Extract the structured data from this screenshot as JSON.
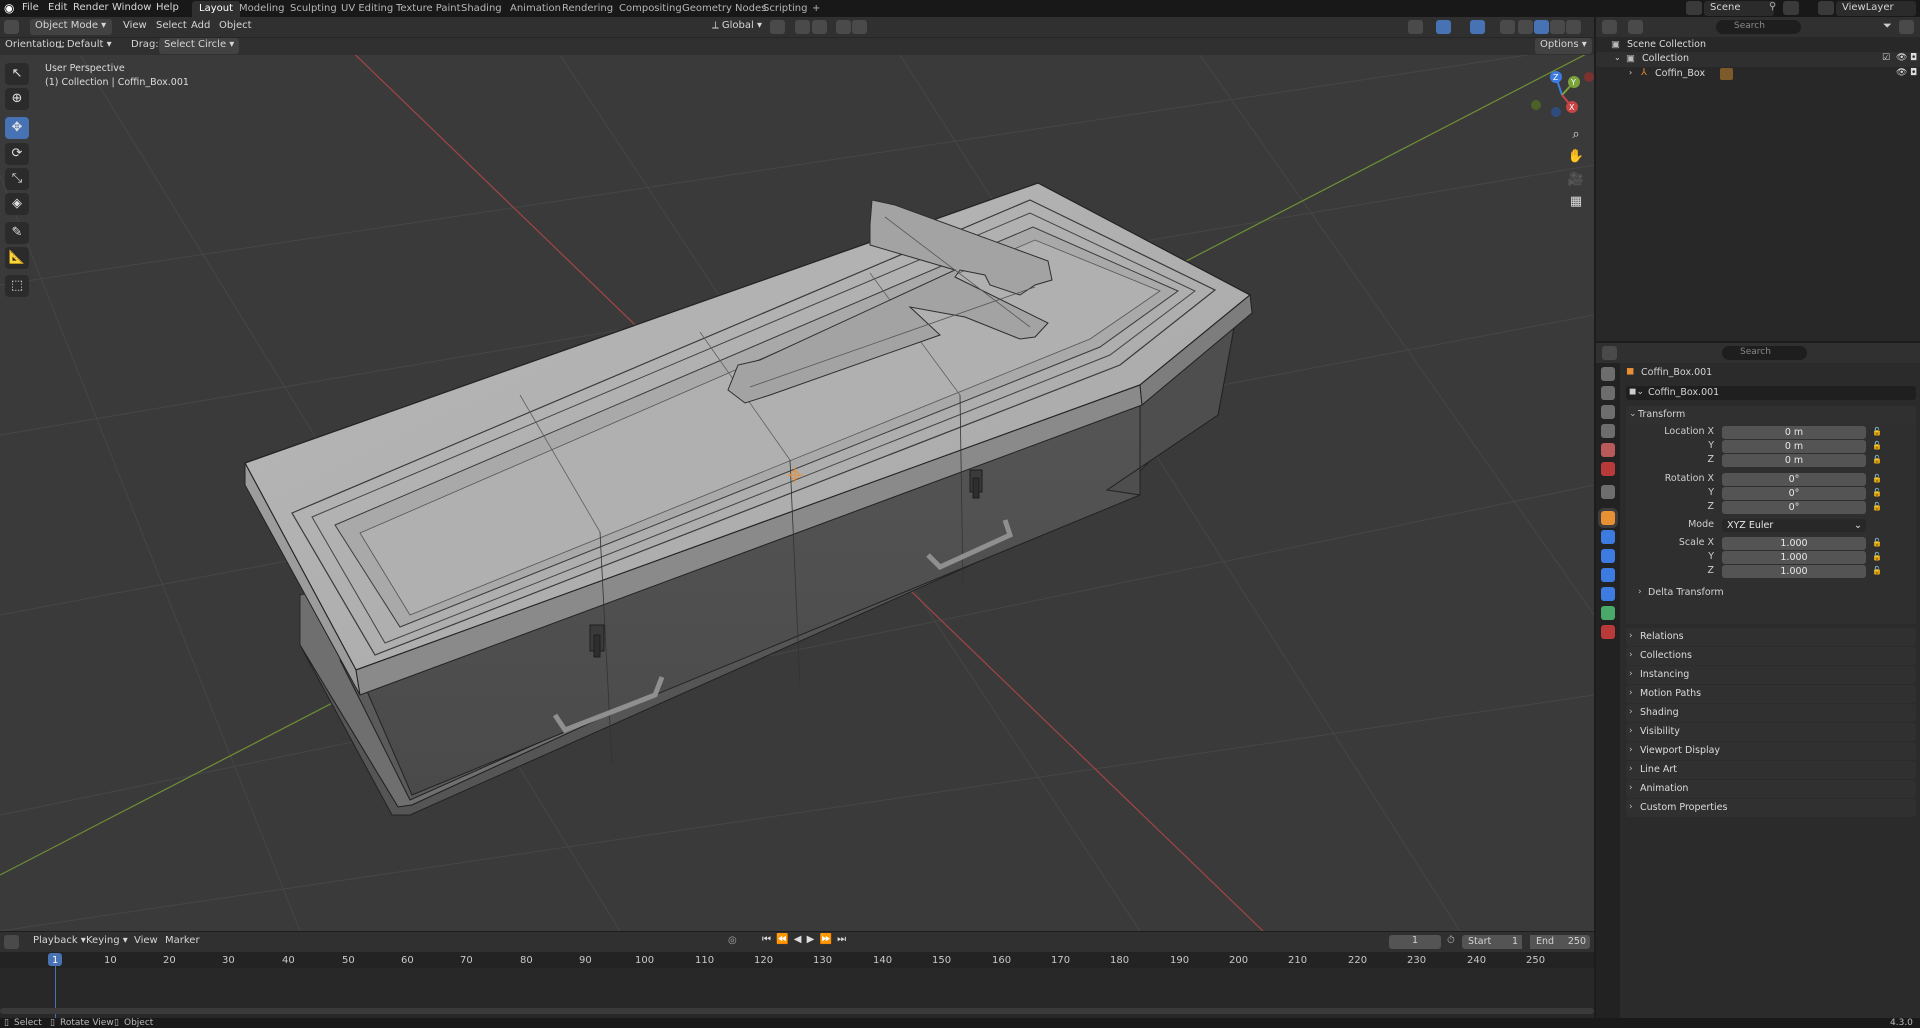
{
  "menu": [
    "File",
    "Edit",
    "Render",
    "Window",
    "Help"
  ],
  "workspaces": [
    "Layout",
    "Modeling",
    "Sculpting",
    "UV Editing",
    "Texture Paint",
    "Shading",
    "Animation",
    "Rendering",
    "Compositing",
    "Geometry Nodes",
    "Scripting"
  ],
  "add_workspace": "+",
  "scene": {
    "name": "Scene",
    "view_layer": "ViewLayer"
  },
  "viewport": {
    "mode": "Object Mode",
    "menus": [
      "View",
      "Select",
      "Add",
      "Object"
    ],
    "transform_orientation": "Global",
    "orientation_label": "Orientation:",
    "orientation_value": "Default",
    "drag_label": "Drag:",
    "drag_value": "Select Circle",
    "options": "Options",
    "overlay_title": "User Perspective",
    "overlay_subtitle": "(1) Collection | Coffin_Box.001",
    "gizmo": {
      "z": "Z",
      "y": "Y",
      "x": "X"
    }
  },
  "outliner": {
    "search_placeholder": "Search",
    "rows": [
      "Scene Collection",
      "Collection",
      "Coffin_Box"
    ]
  },
  "properties": {
    "search_placeholder": "Search",
    "object_name": "Coffin_Box.001",
    "datablock_name": "Coffin_Box.001",
    "transform_title": "Transform",
    "location": {
      "label_x": "Location X",
      "label_y": "Y",
      "label_z": "Z",
      "x": "0 m",
      "y": "0 m",
      "z": "0 m"
    },
    "rotation": {
      "label_x": "Rotation X",
      "label_y": "Y",
      "label_z": "Z",
      "x": "0°",
      "y": "0°",
      "z": "0°"
    },
    "mode": {
      "label": "Mode",
      "value": "XYZ Euler"
    },
    "scale": {
      "label_x": "Scale X",
      "label_y": "Y",
      "label_z": "Z",
      "x": "1.000",
      "y": "1.000",
      "z": "1.000"
    },
    "delta_transform": "Delta Transform",
    "panels": [
      "Relations",
      "Collections",
      "Instancing",
      "Motion Paths",
      "Shading",
      "Visibility",
      "Viewport Display",
      "Line Art",
      "Animation",
      "Custom Properties"
    ]
  },
  "timeline": {
    "menus": [
      "Playback",
      "Keying",
      "View",
      "Marker"
    ],
    "current_frame": "1",
    "start_label": "Start",
    "start": "1",
    "end_label": "End",
    "end": "250",
    "ruler": [
      "1",
      "10",
      "20",
      "30",
      "40",
      "50",
      "60",
      "70",
      "80",
      "90",
      "100",
      "110",
      "120",
      "130",
      "140",
      "150",
      "160",
      "170",
      "180",
      "190",
      "200",
      "210",
      "220",
      "230",
      "240",
      "250"
    ]
  },
  "status": {
    "select": "Select",
    "rotate": "Rotate View",
    "object": "Object",
    "version": "4.3.0"
  },
  "colors": {
    "accent": "#4772b3",
    "x_axis": "#c84444",
    "y_axis": "#7aa33a",
    "z_axis": "#3d7be0",
    "object_orange": "#e89034"
  }
}
